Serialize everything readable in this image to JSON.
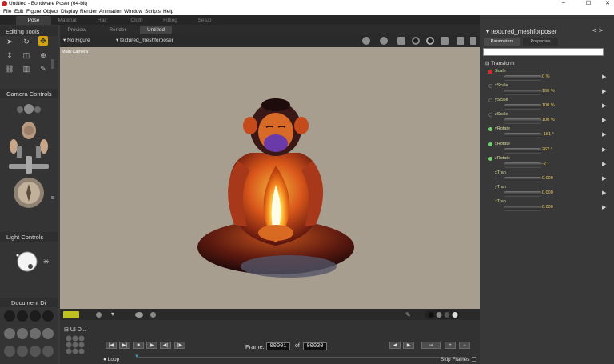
{
  "window": {
    "title": "Untitled - Bondware Poser (64-bit)",
    "minimize": "–",
    "maximize": "☐",
    "close": "✕"
  },
  "menu": [
    "File",
    "Edit",
    "Figure",
    "Object",
    "Display",
    "Render",
    "Animation",
    "Window",
    "Scripts",
    "Help"
  ],
  "rooms": [
    "Pose",
    "Material",
    "Hair",
    "Cloth",
    "Fitting",
    "Setup"
  ],
  "active_room": "Pose",
  "left_panel": {
    "editing_tools": "Editing Tools",
    "camera_controls": "Camera Controls",
    "light_controls": "Light Controls",
    "document_display": "Document Di"
  },
  "doc_tabs": [
    "Preview",
    "Render",
    "Untitled"
  ],
  "view_toolbar": {
    "figure_select": "No Figure",
    "prop_select": "textured_meshforposer"
  },
  "viewport": {
    "camera_label": "Main Camera"
  },
  "right_panel": {
    "object_title": "textured_meshforposer",
    "tabs": [
      "Parameters",
      "Properties"
    ],
    "search_placeholder": "",
    "group": "Transform",
    "params": [
      {
        "name": "Scale",
        "value": "0 %",
        "dot": "#d52a2a"
      },
      {
        "name": "xScale",
        "value": "100 %",
        "dot": ""
      },
      {
        "name": "yScale",
        "value": "100 %",
        "dot": ""
      },
      {
        "name": "zScale",
        "value": "100 %",
        "dot": ""
      },
      {
        "name": "yRotate",
        "value": "-181 °",
        "dot": "#6ed36e"
      },
      {
        "name": "xRotate",
        "value": "262 °",
        "dot": "#6ed36e"
      },
      {
        "name": "zRotate",
        "value": "-2 °",
        "dot": "#6ed36e"
      },
      {
        "name": "xTran",
        "value": "0.000",
        "dot": ""
      },
      {
        "name": "yTran",
        "value": "0.000",
        "dot": ""
      },
      {
        "name": "zTran",
        "value": "0.000",
        "dot": ""
      }
    ]
  },
  "animation": {
    "ui_label": "UI D...",
    "frame_label": "Frame:",
    "current_frame": "00001",
    "of_label": "of",
    "total_frames": "00030",
    "loop_label": "Loop",
    "skip_frames_label": "Skip Frames"
  }
}
